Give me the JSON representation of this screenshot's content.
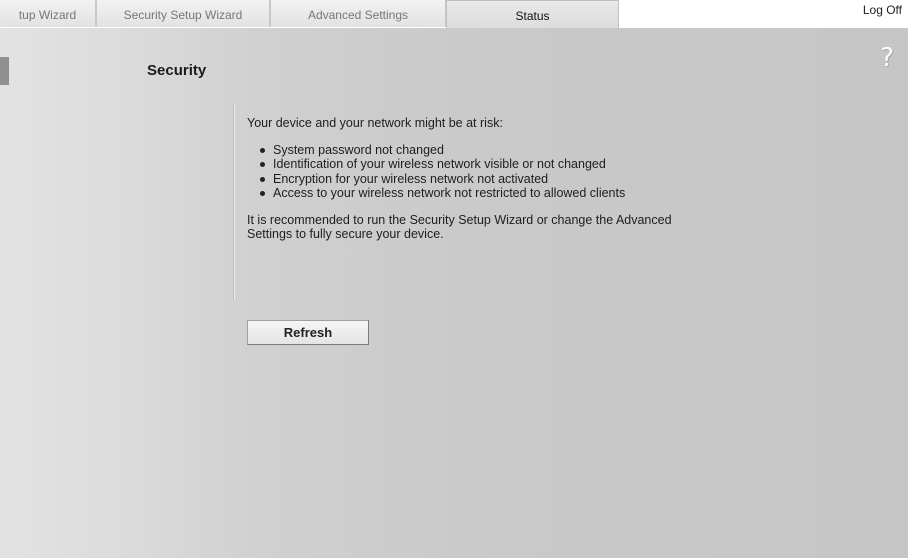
{
  "tabs": [
    {
      "label": "tup Wizard",
      "active": false
    },
    {
      "label": "Security Setup Wizard",
      "active": false
    },
    {
      "label": "Advanced Settings",
      "active": false
    },
    {
      "label": "Status",
      "active": true
    }
  ],
  "header": {
    "logoff_label": "Log Off"
  },
  "help_icon": {
    "icon": "question-mark-icon",
    "glyph": "?"
  },
  "main": {
    "section_title": "Security",
    "intro": "Your device and your network might be at risk:",
    "risks": [
      "System password not changed",
      "Identification of your wireless network visible or not changed",
      "Encryption for your wireless network not activated",
      "Access to your wireless network not restricted to allowed clients"
    ],
    "recommendation": "It is recommended to run the Security Setup Wizard or change the Advanced Settings to fully secure your device.",
    "refresh_label": "Refresh"
  }
}
